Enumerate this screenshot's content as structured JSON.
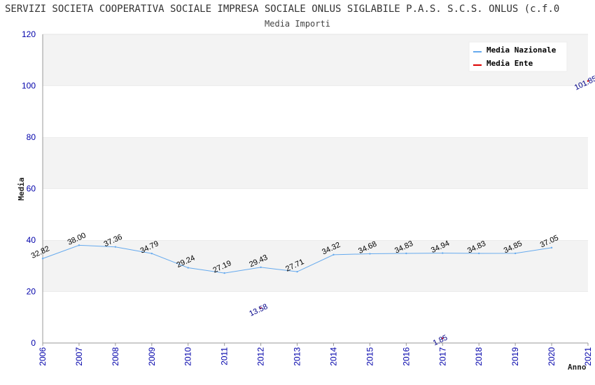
{
  "title": "SERVIZI SOCIETA COOPERATIVA SOCIALE IMPRESA SOCIALE ONLUS SIGLABILE P.A.S. S.C.S. ONLUS (c.f.0",
  "subtitle": "Media Importi",
  "chart_data": {
    "type": "line",
    "title": "SERVIZI SOCIETA COOPERATIVA SOCIALE IMPRESA SOCIALE ONLUS SIGLABILE P.A.S. S.C.S. ONLUS (c.f.0",
    "subtitle": "Media Importi",
    "xlabel": "Anno",
    "ylabel": "Media",
    "ylim": [
      0,
      120
    ],
    "yticks": [
      0,
      20,
      40,
      60,
      80,
      100,
      120
    ],
    "categories": [
      "2006",
      "2007",
      "2008",
      "2009",
      "2010",
      "2011",
      "2012",
      "2013",
      "2014",
      "2015",
      "2016",
      "2017",
      "2018",
      "2019",
      "2020",
      "2021"
    ],
    "grid": "horizontal bands",
    "legend_position": "top-right",
    "series": [
      {
        "name": "Media Nazionale",
        "color": "#66aaee",
        "values": [
          32.82,
          38.0,
          37.36,
          34.79,
          29.24,
          27.19,
          29.43,
          27.71,
          34.32,
          34.68,
          34.83,
          34.94,
          34.83,
          34.85,
          37.05
        ],
        "labels": [
          "32.82",
          "38.00",
          "37.36",
          "34.79",
          "29.24",
          "27.19",
          "29.43",
          "27.71",
          "34.32",
          "34.68",
          "34.83",
          "34.94",
          "34.83",
          "34.85",
          "37.05"
        ]
      },
      {
        "name": "Media Ente",
        "color": "#dd0000",
        "points": [
          {
            "x": "2012",
            "value": 13.58,
            "label": "13.58"
          },
          {
            "x": "2017",
            "value": 1.85,
            "label": "1.85"
          },
          {
            "x": "2021",
            "value": 101.85,
            "label": "101.85"
          }
        ]
      }
    ]
  }
}
